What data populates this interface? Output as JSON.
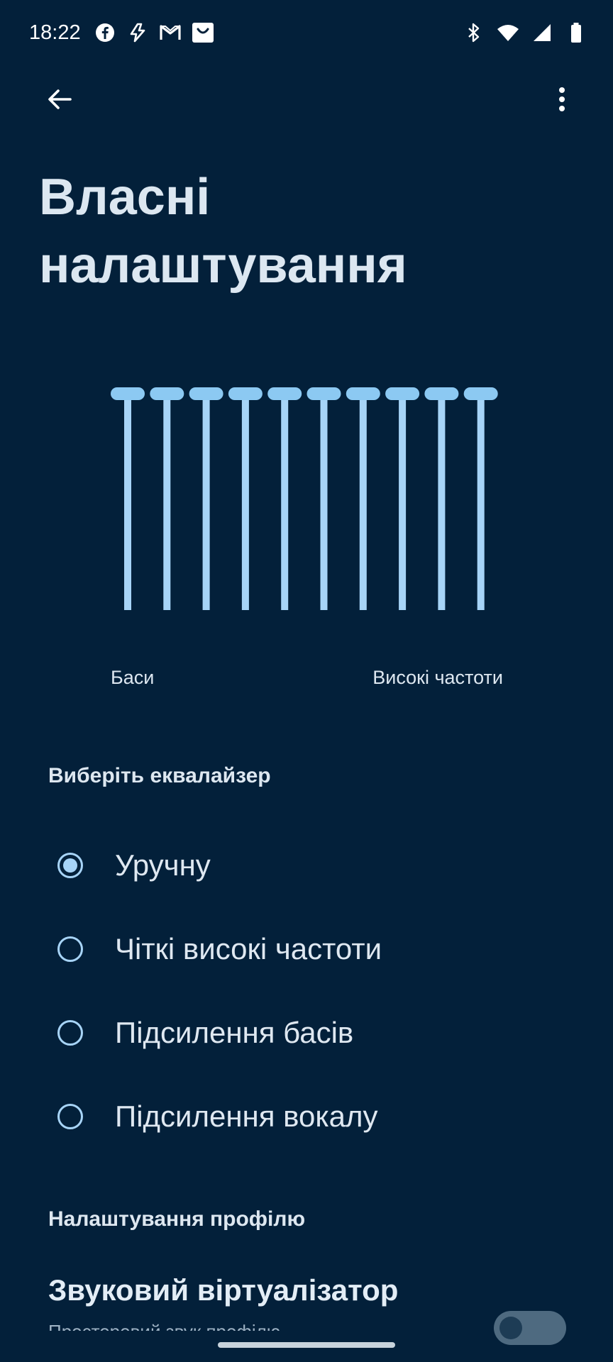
{
  "status_bar": {
    "time": "18:22",
    "left_icons": [
      "facebook-icon",
      "app-notification-icon",
      "gmail-icon",
      "shopping-bag-icon"
    ],
    "right_icons": [
      "bluetooth-icon",
      "wifi-icon",
      "signal-icon",
      "battery-icon"
    ]
  },
  "app_bar": {
    "back_icon": "arrow-back-icon",
    "more_icon": "more-vert-icon"
  },
  "page": {
    "title_line1": "Власні",
    "title_line2": "налаштування"
  },
  "equalizer": {
    "band_count": 10,
    "band_levels": [
      1,
      1,
      1,
      1,
      1,
      1,
      1,
      1,
      1,
      1
    ],
    "label_low": "Баси",
    "label_high": "Високі частоти",
    "color": "#a7d4f7",
    "knob_color": "#8cc9f2"
  },
  "select_equalizer": {
    "header": "Виберіть еквалайзер",
    "options": [
      {
        "label": "Уручну",
        "selected": true
      },
      {
        "label": "Чіткі високі частоти",
        "selected": false
      },
      {
        "label": "Підсилення басів",
        "selected": false
      },
      {
        "label": "Підсилення вокалу",
        "selected": false
      }
    ]
  },
  "profile_settings": {
    "header": "Налаштування профілю",
    "virtualizer_title": "Звуковий віртуалізатор",
    "virtualizer_subtitle": "Просторовий звук профілю"
  },
  "colors": {
    "background": "#03203a",
    "accent": "#a7d4f7",
    "text": "#dfe8f1"
  }
}
